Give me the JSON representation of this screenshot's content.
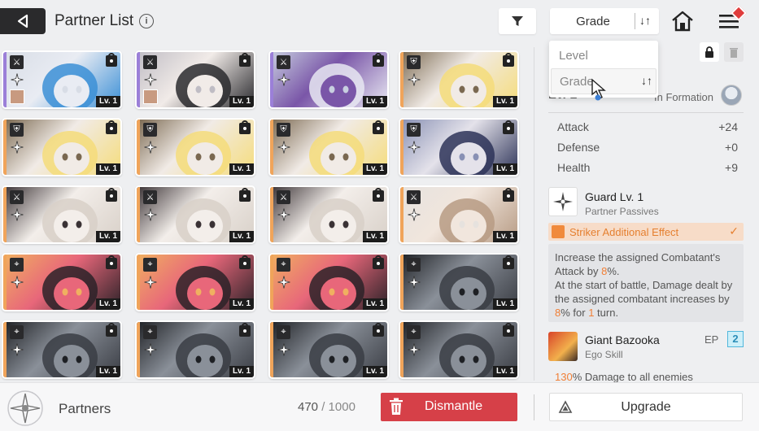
{
  "header": {
    "title": "Partner List",
    "info_glyph": "i",
    "sort_label": "Grade",
    "sort_arrows": "↓↑"
  },
  "dropdown": {
    "options": [
      "Level",
      "Grade"
    ],
    "selected": "Grade",
    "arrows": "↓↑"
  },
  "colors": {
    "accent_orange": "#f07f36",
    "dismantle_red": "#d64048",
    "ep_blue": "#2a8db8",
    "rarity_purple": "#9b7fd8",
    "rarity_orange": "#f0a45a"
  },
  "cards": [
    {
      "role": "crossed-swords-icon",
      "role_glyph": "⚔",
      "level": "Lv. 1",
      "rarity": "purple",
      "equipped": true,
      "palette": [
        "#3b8fd6",
        "#e9ecf3",
        "#d8dde6"
      ]
    },
    {
      "role": "crossed-swords-icon",
      "role_glyph": "⚔",
      "level": "Lv. 1",
      "rarity": "purple",
      "equipped": true,
      "palette": [
        "#2a2a2e",
        "#f1ebe8",
        "#bfbcc4"
      ]
    },
    {
      "role": "crossed-swords-icon",
      "role_glyph": "⚔",
      "level": "Lv. 1",
      "rarity": "purple",
      "equipped": false,
      "palette": [
        "#e8e8f2",
        "#7a56a8",
        "#c8cfe0"
      ]
    },
    {
      "role": "shield-icon",
      "role_glyph": "⛨",
      "level": "Lv. 1",
      "rarity": "orange",
      "equipped": false,
      "palette": [
        "#f5dc7a",
        "#f1ebe6",
        "#7a6850"
      ]
    },
    {
      "role": "shield-icon",
      "role_glyph": "⛨",
      "level": "Lv. 1",
      "rarity": "orange",
      "equipped": false,
      "palette": [
        "#f5dc7a",
        "#f1ebe6",
        "#7a6850"
      ]
    },
    {
      "role": "shield-icon",
      "role_glyph": "⛨",
      "level": "Lv. 1",
      "rarity": "orange",
      "equipped": false,
      "palette": [
        "#f5dc7a",
        "#f1ebe6",
        "#7a6850"
      ]
    },
    {
      "role": "shield-icon",
      "role_glyph": "⛨",
      "level": "Lv. 1",
      "rarity": "orange",
      "equipped": false,
      "palette": [
        "#f5dc7a",
        "#f1ebe6",
        "#7a6850"
      ]
    },
    {
      "role": "shield-icon",
      "role_glyph": "⛨",
      "level": "Lv. 1",
      "rarity": "orange",
      "equipped": false,
      "palette": [
        "#2d3358",
        "#e4e2ea",
        "#8890b4"
      ]
    },
    {
      "role": "crossed-swords-icon",
      "role_glyph": "⚔",
      "level": "Lv. 1",
      "rarity": "orange",
      "equipped": false,
      "palette": [
        "#d8d0c8",
        "#f3eeea",
        "#3a3235"
      ]
    },
    {
      "role": "crossed-swords-icon",
      "role_glyph": "⚔",
      "level": "Lv. 1",
      "rarity": "orange",
      "equipped": false,
      "palette": [
        "#d8d0c8",
        "#f3eeea",
        "#3a3235"
      ]
    },
    {
      "role": "crossed-swords-icon",
      "role_glyph": "⚔",
      "level": "Lv. 1",
      "rarity": "orange",
      "equipped": false,
      "palette": [
        "#d8d0c8",
        "#f3eeea",
        "#3a3235"
      ]
    },
    {
      "role": "crossed-swords-icon",
      "role_glyph": "⚔",
      "level": "Lv. 1",
      "rarity": "orange",
      "equipped": false,
      "palette": [
        "#b79b84",
        "#f1e6dd",
        "#e6e2de"
      ]
    },
    {
      "role": "target-icon",
      "role_glyph": "⌖",
      "level": "Lv. 1",
      "rarity": "orange",
      "equipped": false,
      "palette": [
        "#2b2228",
        "#e8677a",
        "#f0b060"
      ]
    },
    {
      "role": "target-icon",
      "role_glyph": "⌖",
      "level": "Lv. 1",
      "rarity": "orange",
      "equipped": false,
      "palette": [
        "#2b2228",
        "#e8677a",
        "#f0b060"
      ]
    },
    {
      "role": "target-icon",
      "role_glyph": "⌖",
      "level": "Lv. 1",
      "rarity": "orange",
      "equipped": false,
      "palette": [
        "#2b2228",
        "#e8677a",
        "#f0b060"
      ]
    },
    {
      "role": "target-icon",
      "role_glyph": "⌖",
      "level": "Lv. 1",
      "rarity": "orange",
      "equipped": false,
      "palette": [
        "#3a3d44",
        "#8a9099",
        "#1e2024"
      ]
    },
    {
      "role": "target-icon",
      "role_glyph": "⌖",
      "level": "Lv. 1",
      "rarity": "orange",
      "equipped": false,
      "palette": [
        "#3a3d44",
        "#8a9099",
        "#1e2024"
      ]
    },
    {
      "role": "target-icon",
      "role_glyph": "⌖",
      "level": "Lv. 1",
      "rarity": "orange",
      "equipped": false,
      "palette": [
        "#3a3d44",
        "#8a9099",
        "#1e2024"
      ]
    },
    {
      "role": "target-icon",
      "role_glyph": "⌖",
      "level": "Lv. 1",
      "rarity": "orange",
      "equipped": false,
      "palette": [
        "#3a3d44",
        "#8a9099",
        "#1e2024"
      ]
    },
    {
      "role": "target-icon",
      "role_glyph": "⌖",
      "level": "Lv. 1",
      "rarity": "orange",
      "equipped": false,
      "palette": [
        "#3a3d44",
        "#8a9099",
        "#1e2024"
      ]
    }
  ],
  "panel": {
    "level_text": "Lv. 1",
    "formation_label": "In Formation",
    "stats": [
      {
        "label": "Attack",
        "value": "+24"
      },
      {
        "label": "Defense",
        "value": "+0"
      },
      {
        "label": "Health",
        "value": "+9"
      }
    ],
    "passive": {
      "name": "Guard Lv. 1",
      "type": "Partner Passives"
    },
    "striker": {
      "label": "Striker Additional Effect",
      "check": "✓"
    },
    "description": {
      "l1": "Increase the assigned Combatant's",
      "l2a": "Attack by ",
      "l2v": "8",
      "l2b": "%.",
      "l3": "At the start of battle, Damage dealt by",
      "l4": "the assigned combatant increases by",
      "l5v1": "8",
      "l5a": "% for ",
      "l5v2": "1",
      "l5b": " turn."
    },
    "ego": {
      "name": "Giant Bazooka",
      "type": "Ego Skill",
      "ep_label": "EP",
      "ep_value": "2"
    },
    "damage_pct": "130",
    "damage_text": "% Damage to all enemies"
  },
  "footer": {
    "label": "Partners",
    "count": "470",
    "separator": " / ",
    "max": "1000",
    "dismantle": "Dismantle",
    "upgrade": "Upgrade"
  }
}
